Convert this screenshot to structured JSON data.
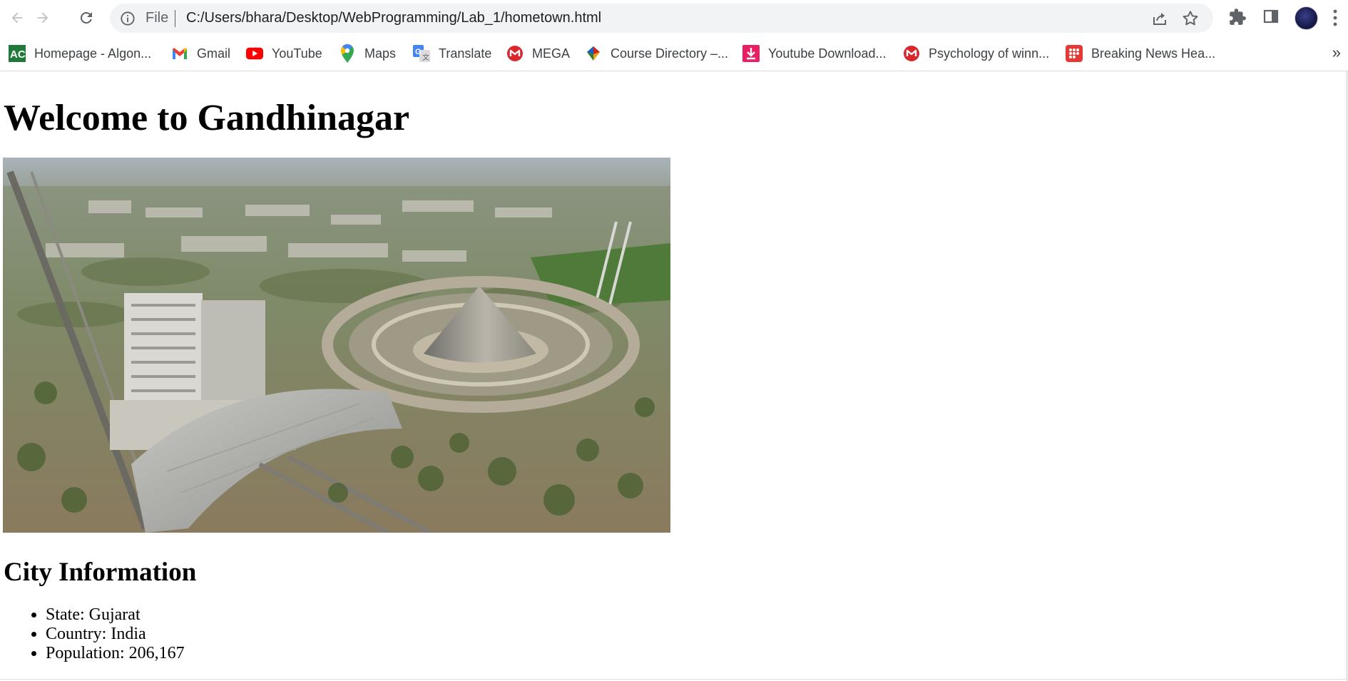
{
  "browser": {
    "back_icon": "arrow-left-icon",
    "forward_icon": "arrow-right-icon",
    "reload_icon": "reload-icon",
    "omnibox": {
      "scheme_label": "File",
      "url": "C:/Users/bhara/Desktop/WebProgramming/Lab_1/hometown.html",
      "info_icon": "info-icon",
      "share_icon": "share-icon",
      "bookmark_icon": "star-icon"
    },
    "extensions_icon": "puzzle-icon",
    "side_panel_icon": "side-panel-icon",
    "menu_icon": "kebab-menu-icon"
  },
  "bookmarks": [
    {
      "label": "Homepage - Algon...",
      "icon": "algonquin-icon",
      "color": "#1f7a3a"
    },
    {
      "label": "Gmail",
      "icon": "gmail-icon",
      "color": "#ea4335"
    },
    {
      "label": "YouTube",
      "icon": "youtube-icon",
      "color": "#ff0000"
    },
    {
      "label": "Maps",
      "icon": "maps-icon",
      "color": "#34a853"
    },
    {
      "label": "Translate",
      "icon": "translate-icon",
      "color": "#4285f4"
    },
    {
      "label": "MEGA",
      "icon": "mega-icon",
      "color": "#d9272e"
    },
    {
      "label": "Course Directory –...",
      "icon": "course-directory-icon",
      "color": "#e8a317"
    },
    {
      "label": "Youtube Download...",
      "icon": "download-icon",
      "color": "#e91e63"
    },
    {
      "label": "Psychology of winn...",
      "icon": "mega-icon",
      "color": "#d9272e"
    },
    {
      "label": "Breaking News Hea...",
      "icon": "news-icon",
      "color": "#e53935"
    }
  ],
  "bookmarks_overflow": "»",
  "page": {
    "heading": "Welcome to Gandhinagar",
    "image_alt": "aerial view of Gandhinagar",
    "section_heading": "City Information",
    "info": [
      {
        "label": "State:",
        "value": "Gujarat"
      },
      {
        "label": "Country:",
        "value": "India"
      },
      {
        "label": "Population:",
        "value": "206,167"
      }
    ]
  }
}
